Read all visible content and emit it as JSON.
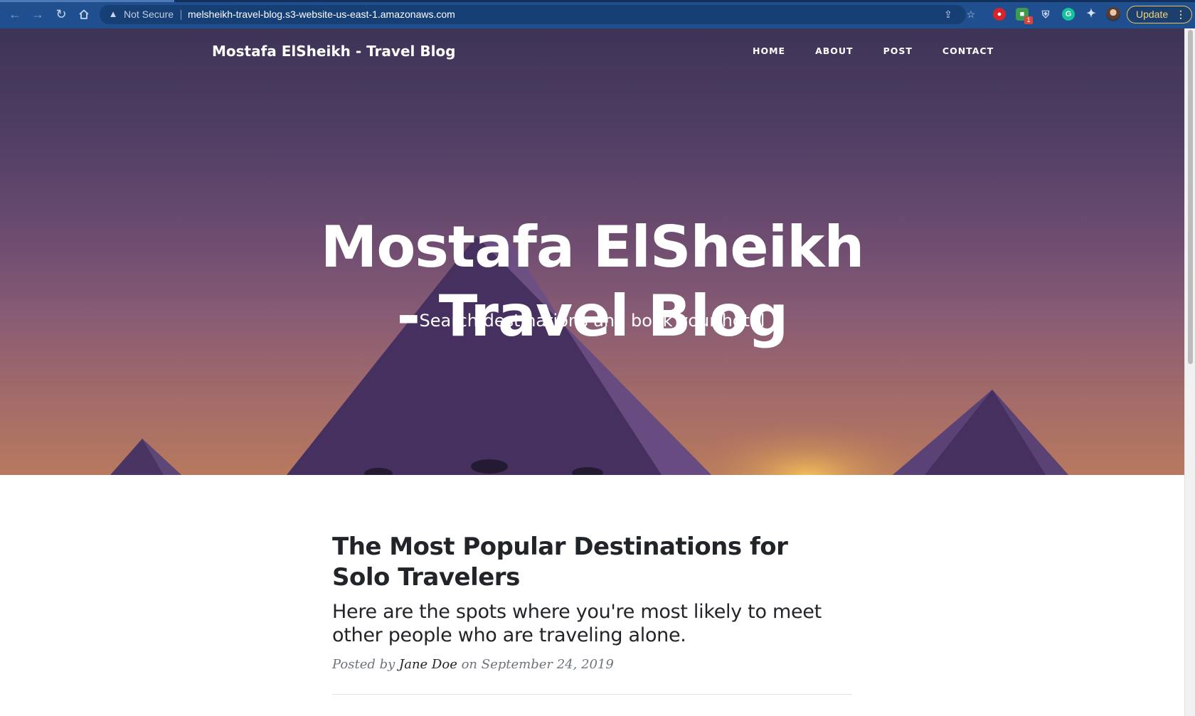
{
  "browser": {
    "back_icon": "arrow-left-icon",
    "forward_icon": "arrow-right-icon",
    "reload_icon": "reload-icon",
    "home_icon": "home-icon",
    "security_label": "Not Secure",
    "url": "melsheikh-travel-blog.s3-website-us-east-1.amazonaws.com",
    "extension_badge": "1",
    "update_label": "Update"
  },
  "site": {
    "brand": "Mostafa ElSheikh - Travel Blog",
    "nav": [
      "HOME",
      "ABOUT",
      "POST",
      "CONTACT"
    ]
  },
  "hero": {
    "title_line1": "Mostafa ElSheikh",
    "title_line2": "- Travel Blog",
    "subtitle": "Search destinations and book your hotel"
  },
  "post": {
    "title": "The Most Popular Destinations for Solo Travelers",
    "subtitle": "Here are the spots where you're most likely to meet other people who are traveling alone.",
    "meta_prefix": "Posted by",
    "author": "Jane Doe",
    "meta_mid": "on",
    "date": "September 24, 2019"
  },
  "colors": {
    "chrome": "#1f4f8f",
    "hero_top": "#3e3457",
    "hero_bottom": "#b7795e",
    "pyramid": "#45305f",
    "text_dark": "#212529",
    "text_muted": "#6c757d"
  }
}
